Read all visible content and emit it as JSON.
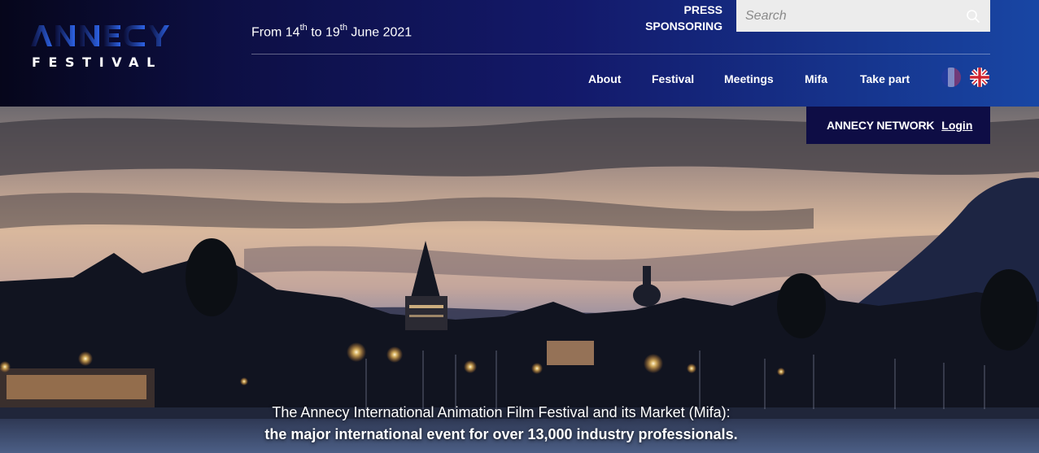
{
  "brand": {
    "name": "ANNECY",
    "subtitle": "FESTIVAL"
  },
  "dates": {
    "prefix": "From 14",
    "sup1": "th",
    "middle": " to 19",
    "sup2": "th",
    "suffix": " June 2021"
  },
  "top_links": {
    "press": "PRESS",
    "sponsoring": "SPONSORING"
  },
  "search": {
    "placeholder": "Search",
    "value": ""
  },
  "nav": [
    {
      "label": "About"
    },
    {
      "label": "Festival"
    },
    {
      "label": "Meetings"
    },
    {
      "label": "Mifa"
    },
    {
      "label": "Take part"
    }
  ],
  "languages": [
    {
      "icon": "flag-fr-icon",
      "active": false
    },
    {
      "icon": "flag-uk-icon",
      "active": true
    }
  ],
  "network": {
    "label": "ANNECY NETWORK",
    "login": "Login"
  },
  "hero": {
    "line1": "The Annecy International Animation Film Festival and its Market (Mifa):",
    "line2": "the major international event for over 13,000 industry professionals."
  },
  "colors": {
    "header_start": "#06061b",
    "header_end": "#1846a4",
    "network_bg": "#0e0d45",
    "logo_blue": "#2b4fd6"
  }
}
